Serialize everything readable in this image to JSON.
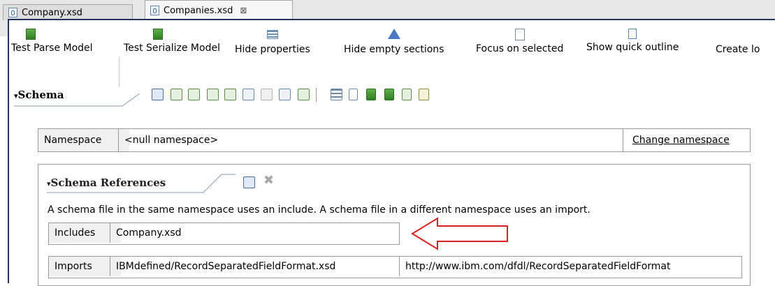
{
  "tabs": [
    {
      "label": "Company.xsd",
      "active": false
    },
    {
      "label": "Companies.xsd",
      "active": true,
      "close_glyph": "⊠"
    }
  ],
  "toolbar": {
    "items": [
      {
        "label": "Test Parse Model",
        "icon": "test-parse-icon"
      },
      {
        "label": "Test Serialize Model",
        "icon": "test-serialize-icon"
      },
      {
        "label": "Hide properties",
        "icon": "hide-properties-icon"
      },
      {
        "label": "Hide empty sections",
        "icon": "hide-empty-sections-icon"
      },
      {
        "label": "Focus on selected",
        "icon": "focus-on-selected-icon"
      },
      {
        "label": "Show quick outline",
        "icon": "show-quick-outline-icon"
      },
      {
        "label": "Create lo",
        "icon": "create-log-icon"
      }
    ]
  },
  "schema": {
    "title": "Schema",
    "namespace_label": "Namespace",
    "namespace_value": "<null namespace>",
    "change_namespace_link": "Change namespace"
  },
  "schema_references": {
    "title": "Schema References",
    "description": "A schema file in the same namespace uses an include. A schema file in a different namespace uses an import.",
    "includes_label": "Includes",
    "includes_value": "Company.xsd",
    "imports_label": "Imports",
    "imports_location": "IBMdefined/RecordSeparatedFieldFormat.xsd",
    "imports_namespace": "http://www.ibm.com/dfdl/RecordSeparatedFieldFormat"
  },
  "colors": {
    "frame": "#23335b",
    "arrow": "#e02020",
    "accent": "#3a6fb0"
  }
}
